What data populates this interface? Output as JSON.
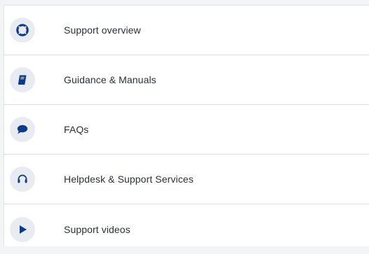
{
  "accent_color": "#0b3a8f",
  "menu": {
    "items": [
      {
        "label": "Support overview",
        "icon": "lifebuoy-icon"
      },
      {
        "label": "Guidance & Manuals",
        "icon": "book-icon"
      },
      {
        "label": "FAQs",
        "icon": "speech-bubble-icon"
      },
      {
        "label": "Helpdesk & Support Services",
        "icon": "headset-icon"
      },
      {
        "label": "Support videos",
        "icon": "play-icon"
      }
    ]
  }
}
